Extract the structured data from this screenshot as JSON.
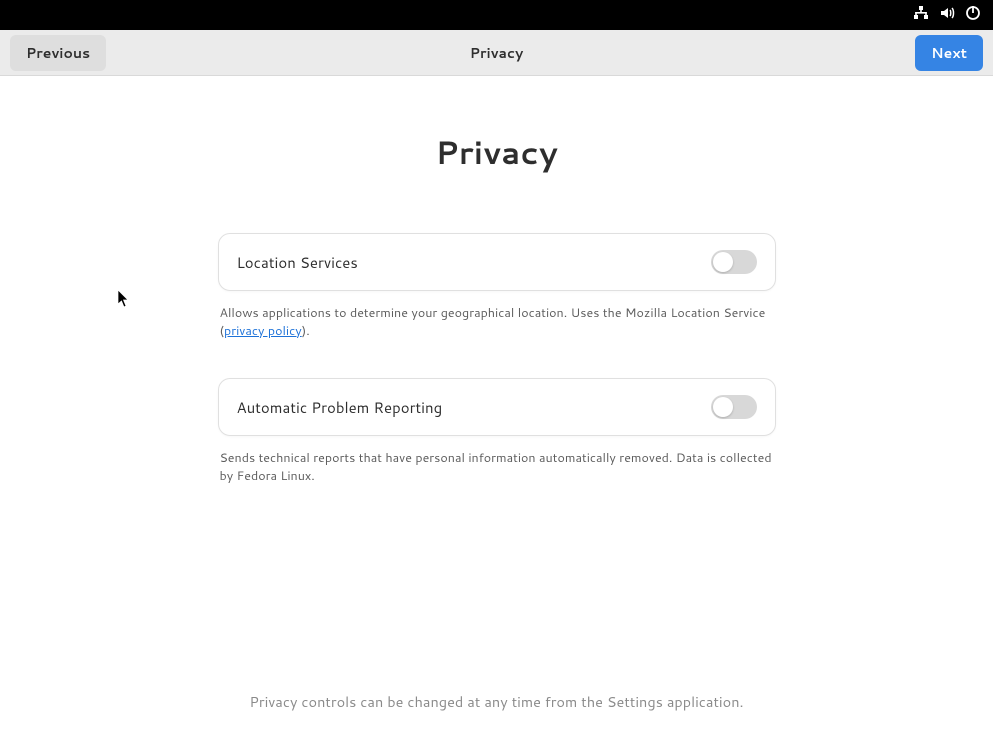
{
  "topbar": {
    "icons": [
      "network",
      "volume",
      "power"
    ]
  },
  "header": {
    "title": "Privacy",
    "previous_label": "Previous",
    "next_label": "Next"
  },
  "main": {
    "page_title": "Privacy",
    "settings": [
      {
        "label": "Location Services",
        "enabled": false,
        "desc_before": "Allows applications to determine your geographical location. Uses the Mozilla Location Service (",
        "link_text": "privacy policy",
        "desc_after": ")."
      },
      {
        "label": "Automatic Problem Reporting",
        "enabled": false,
        "desc": "Sends technical reports that have personal information automatically removed. Data is collected by Fedora Linux."
      }
    ],
    "footer_note": "Privacy controls can be changed at any time from the Settings application."
  }
}
